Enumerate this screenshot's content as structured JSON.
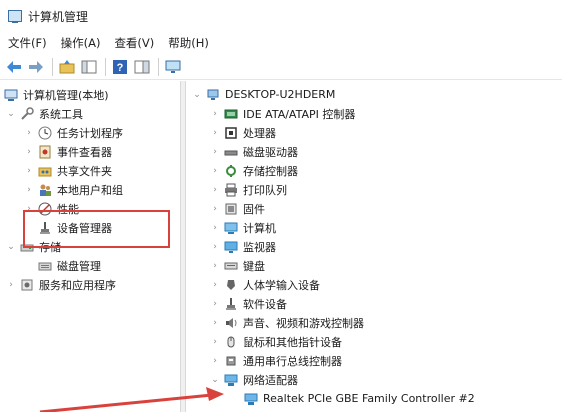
{
  "window": {
    "title": "计算机管理"
  },
  "menu": [
    "文件(F)",
    "操作(A)",
    "查看(V)",
    "帮助(H)"
  ],
  "left_tree": [
    {
      "label": "计算机管理(本地)",
      "chevron": "",
      "icon": "computer-mgmt-icon"
    },
    {
      "label": "系统工具",
      "chevron": "⌄",
      "icon": "tools-icon"
    },
    {
      "label": "任务计划程序",
      "chevron": "›",
      "icon": "clock-icon"
    },
    {
      "label": "事件查看器",
      "chevron": "›",
      "icon": "event-viewer-icon"
    },
    {
      "label": "共享文件夹",
      "chevron": "›",
      "icon": "shared-folder-icon"
    },
    {
      "label": "本地用户和组",
      "chevron": "›",
      "icon": "users-icon"
    },
    {
      "label": "性能",
      "chevron": "›",
      "icon": "performance-icon"
    },
    {
      "label": "设备管理器",
      "chevron": "",
      "icon": "device-manager-icon"
    },
    {
      "label": "存储",
      "chevron": "⌄",
      "icon": "storage-icon"
    },
    {
      "label": "磁盘管理",
      "chevron": "",
      "icon": "disk-mgmt-icon"
    },
    {
      "label": "服务和应用程序",
      "chevron": "›",
      "icon": "services-icon"
    }
  ],
  "right_tree": [
    {
      "label": "DESKTOP-U2HDERM",
      "chevron": "⌄",
      "icon": "computer-icon"
    },
    {
      "label": "IDE ATA/ATAPI 控制器",
      "chevron": "›",
      "icon": "ide-icon"
    },
    {
      "label": "处理器",
      "chevron": "›",
      "icon": "cpu-icon"
    },
    {
      "label": "磁盘驱动器",
      "chevron": "›",
      "icon": "disk-drive-icon"
    },
    {
      "label": "存储控制器",
      "chevron": "›",
      "icon": "storage-controller-icon"
    },
    {
      "label": "打印队列",
      "chevron": "›",
      "icon": "printer-icon"
    },
    {
      "label": "固件",
      "chevron": "›",
      "icon": "firmware-icon"
    },
    {
      "label": "计算机",
      "chevron": "›",
      "icon": "computer-icon"
    },
    {
      "label": "监视器",
      "chevron": "›",
      "icon": "monitor-icon"
    },
    {
      "label": "键盘",
      "chevron": "›",
      "icon": "keyboard-icon"
    },
    {
      "label": "人体学输入设备",
      "chevron": "›",
      "icon": "hid-icon"
    },
    {
      "label": "软件设备",
      "chevron": "›",
      "icon": "software-device-icon"
    },
    {
      "label": "声音、视频和游戏控制器",
      "chevron": "›",
      "icon": "sound-icon"
    },
    {
      "label": "鼠标和其他指针设备",
      "chevron": "›",
      "icon": "mouse-icon"
    },
    {
      "label": "通用串行总线控制器",
      "chevron": "›",
      "icon": "usb-icon"
    },
    {
      "label": "网络适配器",
      "chevron": "⌄",
      "icon": "network-icon"
    },
    {
      "label": "Realtek PCIe GBE Family Controller #2",
      "chevron": "",
      "icon": "network-adapter-icon"
    }
  ],
  "colors": {
    "annotation_red": "#d9423c",
    "accent_blue": "#2b6cb0"
  }
}
